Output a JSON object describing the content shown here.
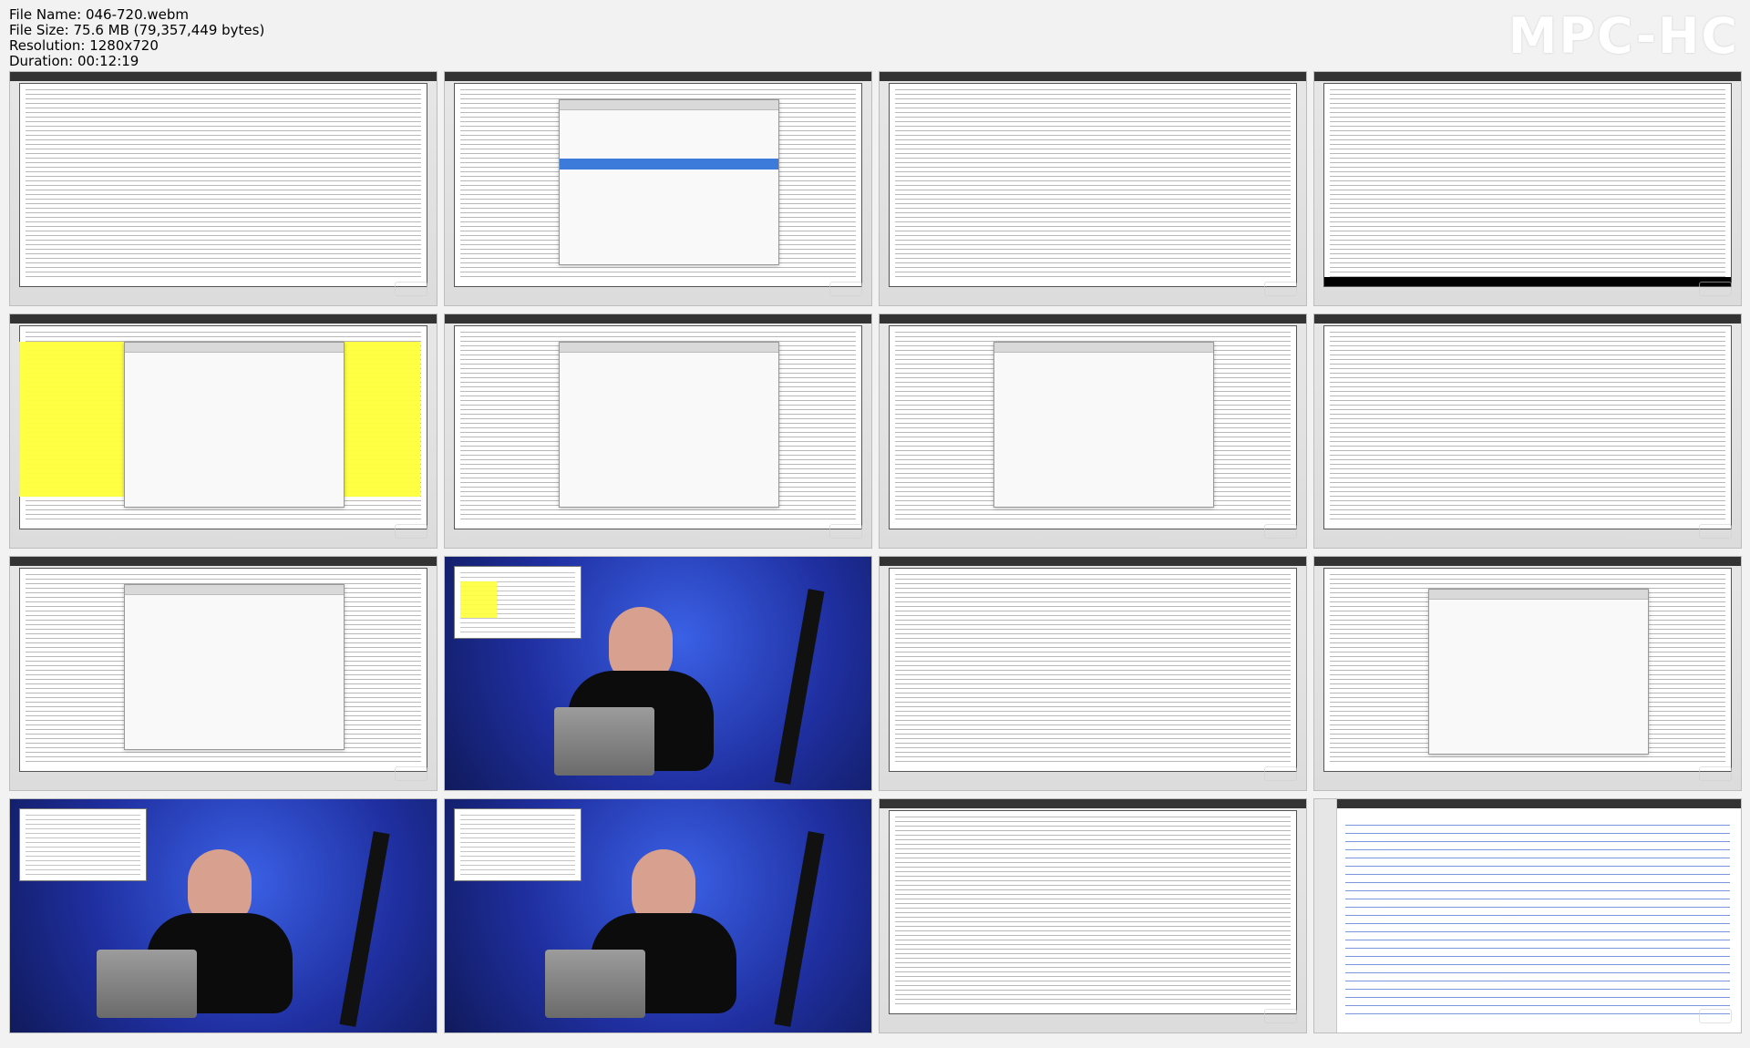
{
  "file_info": {
    "name_line": "File Name: 046-720.webm",
    "size_line": "File Size: 75.6 MB (79,357,449 bytes)",
    "resolution_line": "Resolution: 1280x720",
    "duration_line": "Duration: 00:12:19"
  },
  "brand": "MPC-HC"
}
